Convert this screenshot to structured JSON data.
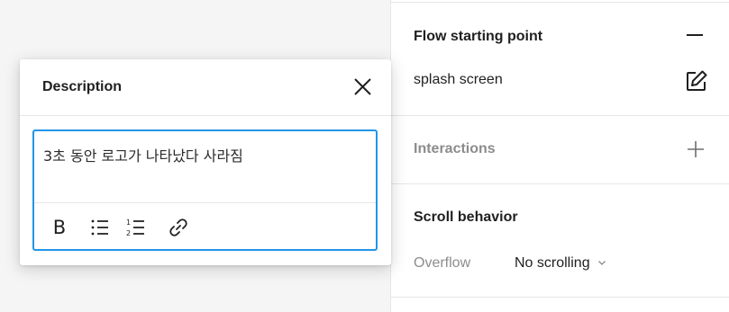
{
  "panel": {
    "flow": {
      "title": "Flow starting point",
      "name": "splash screen"
    },
    "interactions": {
      "title": "Interactions"
    },
    "scroll": {
      "title": "Scroll behavior",
      "overflow_label": "Overflow",
      "overflow_value": "No scrolling"
    }
  },
  "popover": {
    "title": "Description",
    "text": "3초 동안 로고가 나타났다 사라짐",
    "toolbar": {
      "bold_label": "B"
    }
  },
  "icons": {
    "collapse": "minus-icon",
    "edit": "edit-icon",
    "add": "plus-icon",
    "dropdown": "chevron-down-icon",
    "close": "close-icon",
    "bullet_list": "bulleted-list-icon",
    "numbered_list": "numbered-list-icon",
    "link": "link-icon"
  },
  "colors": {
    "focus_border": "#2196e8",
    "muted_text": "#8c8c8c",
    "canvas_bg": "#f5f5f5"
  }
}
